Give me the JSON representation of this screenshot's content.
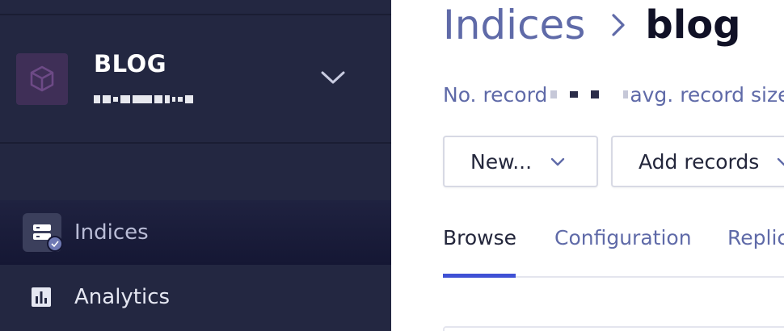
{
  "sidebar": {
    "app": {
      "name": "BLOG",
      "subtitle_redacted": true
    },
    "nav": [
      {
        "label": "Indices",
        "icon": "database-icon",
        "active": true
      },
      {
        "label": "Analytics",
        "icon": "bar-chart-icon",
        "active": false
      }
    ]
  },
  "main": {
    "breadcrumb": {
      "root": "Indices",
      "current": "blog"
    },
    "stats": {
      "records_label": "No. record",
      "avg_label": "avg. record size"
    },
    "buttons": {
      "new": "New...",
      "add": "Add records"
    },
    "tabs": [
      {
        "label": "Browse",
        "active": true
      },
      {
        "label": "Configuration",
        "active": false
      },
      {
        "label": "Replic",
        "active": false
      }
    ]
  },
  "colors": {
    "sidebar_bg": "#232741",
    "accent": "#3f51d5",
    "link": "#5f6aa8"
  }
}
